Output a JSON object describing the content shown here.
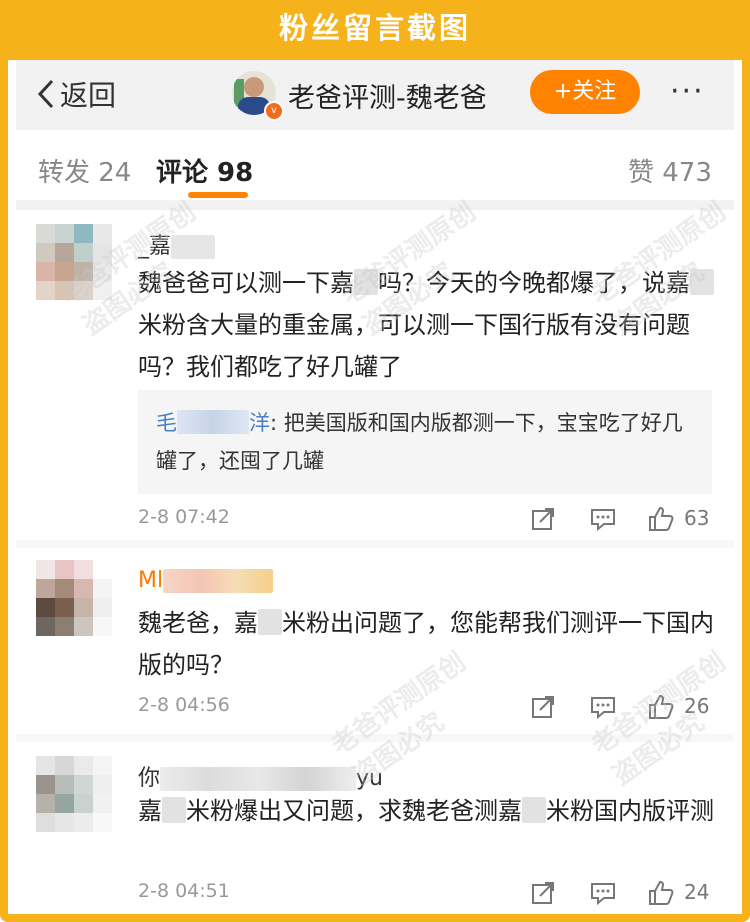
{
  "caption": "粉丝留言截图",
  "nav": {
    "back_label": "返回",
    "account_name": "老爸评测-魏老爸",
    "follow_label": "+关注",
    "more_label": "···"
  },
  "tabs": {
    "repost": "转发 24",
    "comments": "评论 98",
    "likes": "赞 473"
  },
  "comments": [
    {
      "username_visible": "_嘉",
      "text_parts": [
        "魏爸爸可以测一下嘉",
        "吗？今天的今晚都爆了，说嘉",
        "米粉含大量的重金属，可以测一下国行版有没有问题吗？我们都吃了好几罐了"
      ],
      "reply": {
        "name_start": "毛",
        "name_end": "洋",
        "text": ": 把美国版和国内版都测一下，宝宝吃了好几罐了，还囤了几罐"
      },
      "time": "2-8 07:42",
      "likes": "63"
    },
    {
      "username_visible": "Ml",
      "text_parts": [
        "魏老爸，嘉",
        "米粉出问题了，您能帮我们测评一下国内版的吗？"
      ],
      "time": "2-8 04:56",
      "likes": "26"
    },
    {
      "username_start": "你",
      "username_end": "yu",
      "text_parts": [
        "嘉",
        "米粉爆出又问题，求魏老爸测嘉",
        "米粉国内版评测"
      ],
      "time": "2-8 04:51",
      "likes": "24"
    }
  ],
  "watermark": [
    "老爸评测原创",
    "盗图必究"
  ],
  "colors": {
    "accent": "#f6b21b",
    "follow": "#ff8200",
    "link": "#4a7fc1"
  }
}
